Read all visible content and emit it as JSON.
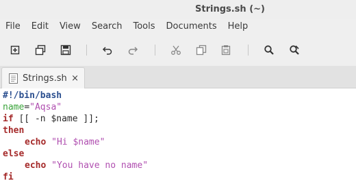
{
  "window": {
    "title": "Strings.sh (~)"
  },
  "menu": [
    "File",
    "Edit",
    "View",
    "Search",
    "Tools",
    "Documents",
    "Help"
  ],
  "toolbar": {
    "icons": [
      "new-document-icon",
      "open-copy-icon",
      "save-icon",
      "undo-icon",
      "redo-icon",
      "cut-icon",
      "copy-icon",
      "paste-icon",
      "search-icon",
      "search-replace-icon"
    ]
  },
  "tab": {
    "label": "Strings.sh",
    "close": "×"
  },
  "code": {
    "line1": "#!/bin/bash",
    "line2_var": "name",
    "line2_eq": "=",
    "line2_str": "\"Aqsa\"",
    "line3_kw": "if",
    "line3_rest": " [[ -n $name ]];",
    "line4_kw": "then",
    "line5_kw": "echo",
    "line5_str": "\"Hi $name\"",
    "line6_kw": "else",
    "line7_kw": "echo",
    "line7_str": "\"You have no name\"",
    "line8_kw": "fi"
  },
  "colors": {
    "keyword": "#a52a2a",
    "shebang": "#2b4f8f",
    "variable": "#3aa33a",
    "string": "#b04fb0"
  }
}
